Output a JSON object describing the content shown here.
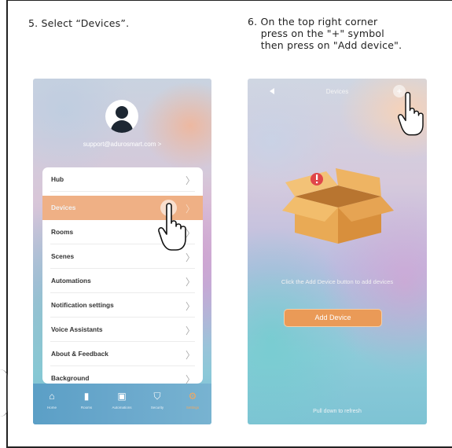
{
  "instructions": {
    "step5": "5. Select “Devices”.",
    "step6": "6. On the top right corner\n    press on the \"+\" symbol\n    then press on \"Add device\"."
  },
  "left_screen": {
    "email": "support@adurosmart.com >",
    "menu_items": [
      {
        "label": "Hub"
      },
      {
        "label": "Devices"
      },
      {
        "label": "Rooms"
      },
      {
        "label": "Scenes"
      },
      {
        "label": "Automations"
      },
      {
        "label": "Notification settings"
      },
      {
        "label": "Voice Assistants"
      },
      {
        "label": "About & Feedback"
      },
      {
        "label": "Background"
      }
    ],
    "active_item": "Devices",
    "tabs": [
      {
        "label": "Home",
        "icon": "home-icon"
      },
      {
        "label": "Rooms",
        "icon": "rooms-icon"
      },
      {
        "label": "Automations",
        "icon": "automations-icon"
      },
      {
        "label": "Security",
        "icon": "shield-icon"
      },
      {
        "label": "Settings",
        "icon": "gear-icon"
      }
    ],
    "selected_tab": "Settings"
  },
  "right_screen": {
    "title": "Devices",
    "plus_symbol": "+",
    "empty_message": "Click the Add Device button to add devices",
    "add_button": "Add Device",
    "pull_refresh": "Pull down to refresh"
  },
  "colors": {
    "accent_orange": "#ea9a57",
    "active_row": "#efb085",
    "tabbar_blue": "#5b9fc6"
  }
}
